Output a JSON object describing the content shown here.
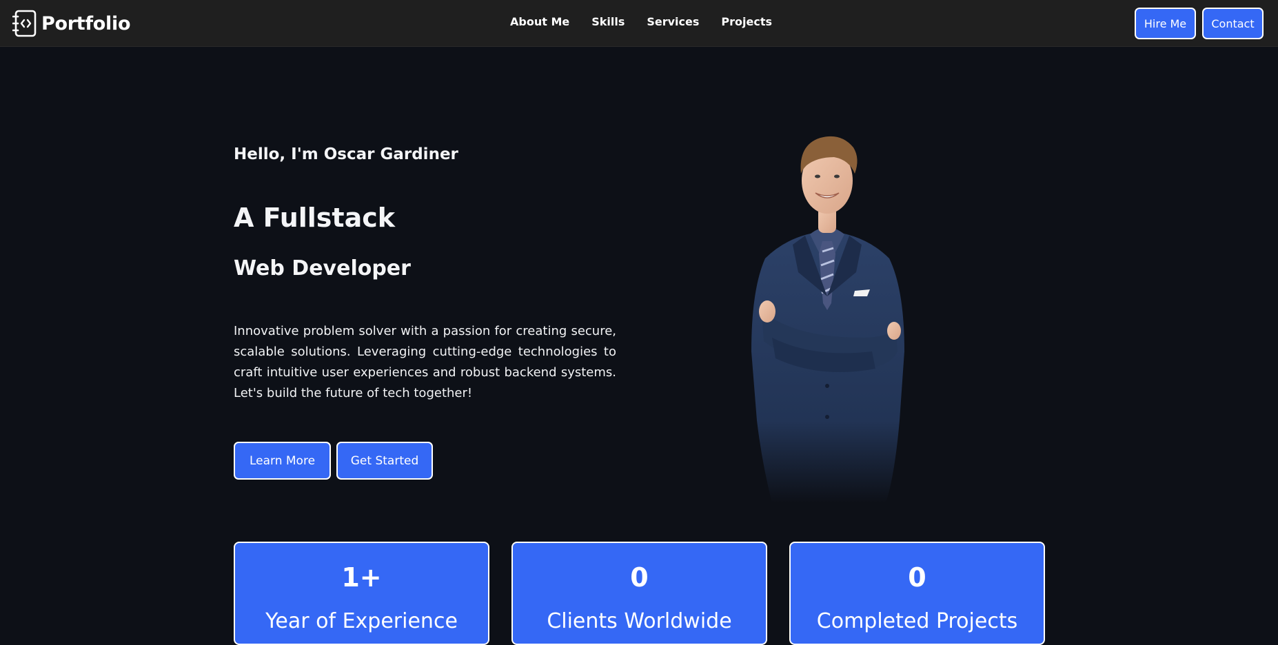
{
  "navbar": {
    "brand": "Portfolio",
    "brand_icon": "code-notebook-icon",
    "links": [
      "About Me",
      "Skills",
      "Services",
      "Projects"
    ],
    "hire_label": "Hire Me",
    "contact_label": "Contact",
    "accent_color": "#3568f5",
    "background_color": "#1f1f1f"
  },
  "hero": {
    "greeting": "Hello, I'm Oscar Gardiner",
    "headline": "A Fullstack",
    "subheadline": "Web Developer",
    "bio": "Innovative problem solver with a passion for creating secure, scalable solutions. Leveraging cutting-edge technologies to craft intuitive user experiences and robust backend systems. Let's build the future of tech together!",
    "learn_more_label": "Learn More",
    "get_started_label": "Get Started",
    "portrait_alt": "portrait-photo"
  },
  "stats": [
    {
      "value": "1+",
      "label": "Year of Experience"
    },
    {
      "value": "0",
      "label": "Clients Worldwide"
    },
    {
      "value": "0",
      "label": "Completed Projects"
    }
  ],
  "colors": {
    "page_background": "#0d1017",
    "button_fill": "#3568f5",
    "button_border": "#ffffff"
  }
}
